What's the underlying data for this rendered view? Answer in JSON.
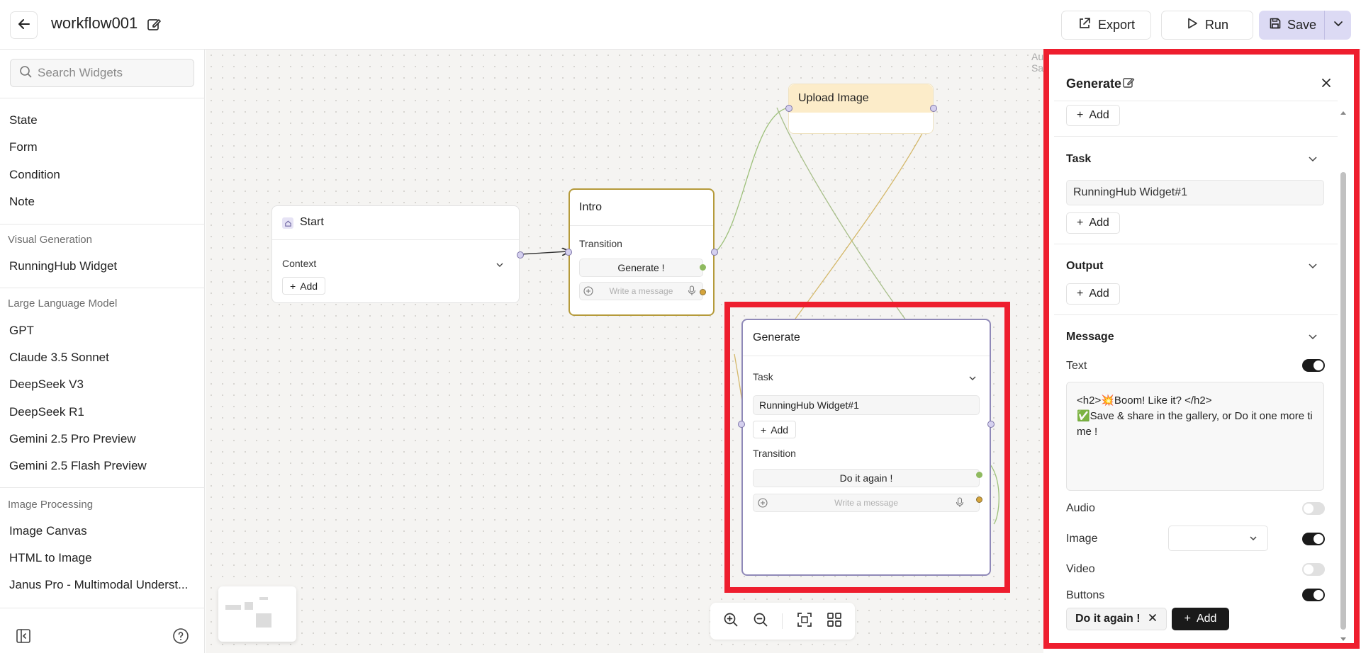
{
  "header": {
    "workflow_title": "workflow001",
    "export_label": "Export",
    "run_label": "Run",
    "save_label": "Save"
  },
  "sidebar": {
    "search_placeholder": "Search Widgets",
    "basic_items": [
      "State",
      "Form",
      "Condition",
      "Note"
    ],
    "groups": [
      {
        "title": "Visual Generation",
        "items": [
          "RunningHub Widget"
        ]
      },
      {
        "title": "Large Language Model",
        "items": [
          "GPT",
          "Claude 3.5 Sonnet",
          "DeepSeek V3",
          "DeepSeek R1",
          "Gemini 2.5 Pro Preview",
          "Gemini 2.5 Flash Preview"
        ]
      },
      {
        "title": "Image Processing",
        "items": [
          "Image Canvas",
          "HTML to Image",
          "Janus Pro - Multimodal Underst..."
        ]
      }
    ]
  },
  "canvas": {
    "start_node": {
      "title": "Start",
      "context_label": "Context",
      "add_label": "Add"
    },
    "intro_node": {
      "title": "Intro",
      "transition_label": "Transition",
      "button_label": "Generate !",
      "message_placeholder": "Write a message"
    },
    "upload_node": {
      "title": "Upload Image"
    },
    "generate_node": {
      "title": "Generate",
      "task_label": "Task",
      "task_value": "RunningHub Widget#1",
      "add_label": "Add",
      "transition_label": "Transition",
      "button_label": "Do it again !",
      "message_placeholder": "Write a message"
    },
    "autosave_text": "Auto Saved"
  },
  "panel": {
    "title": "Generate",
    "add_label": "Add",
    "task": {
      "label": "Task",
      "value": "RunningHub Widget#1",
      "add_label": "Add"
    },
    "output": {
      "label": "Output",
      "add_label": "Add"
    },
    "message": {
      "label": "Message",
      "text_label": "Text",
      "text_value": "<h2>💥Boom! Like it? </h2>\n✅Save & share in the gallery, or Do it one more time !",
      "text_on": true,
      "audio_label": "Audio",
      "audio_on": false,
      "image_label": "Image",
      "image_select": "",
      "image_on": true,
      "video_label": "Video",
      "video_on": false,
      "buttons_label": "Buttons",
      "buttons_on": true,
      "button_chip": "Do it again !",
      "add_button_label": "Add"
    }
  },
  "colors": {
    "highlight": "#ee1e2e",
    "save_bg": "#dcdaf4",
    "accent_node_border": "#b59a3a",
    "generate_border": "#8f89b8"
  }
}
